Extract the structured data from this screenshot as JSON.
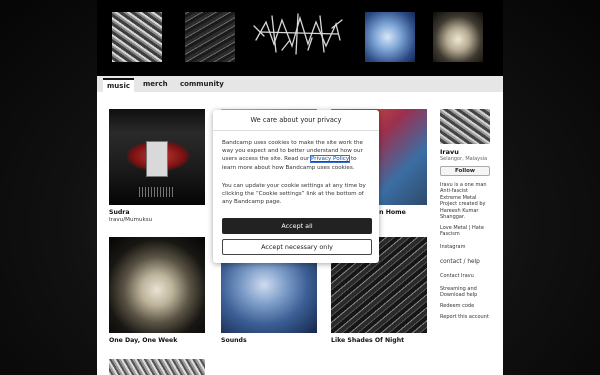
{
  "header": {
    "images": [
      "album-art-thumbnail",
      "album-art-thumbnail",
      "band-logo",
      "album-art-thumbnail",
      "album-art-thumbnail"
    ]
  },
  "tabs": [
    {
      "label": "music",
      "active": true
    },
    {
      "label": "merch",
      "active": false
    },
    {
      "label": "community",
      "active": false
    }
  ],
  "albums": [
    {
      "title": "Sudra",
      "artist": "Iravu/Mumuksu"
    },
    {
      "title": "",
      "artist": ""
    },
    {
      "title": "an Home",
      "artist": ""
    },
    {
      "title": "One Day, One Week",
      "artist": ""
    },
    {
      "title": "Sounds",
      "artist": ""
    },
    {
      "title": "Like Shades Of Night",
      "artist": ""
    },
    {
      "title": "",
      "artist": ""
    }
  ],
  "sidebar": {
    "name": "Iravu",
    "location": "Selangor, Malaysia",
    "follow_label": "Follow",
    "bio_lines": [
      "Iravu is a one man",
      "Anti-fascist",
      "Extreme Metal",
      "Project created by",
      "Hareesh Kumar",
      "Shanggar."
    ],
    "links": [
      "Love Metal | Hate",
      "Fascism",
      "Instagram"
    ],
    "contact_heading": "contact / help",
    "help_links": [
      "Contact Iravu",
      "Streaming and",
      "Download help",
      "Redeem code",
      "Report this account"
    ]
  },
  "cookie_modal": {
    "title": "We care about your privacy",
    "body_before_link": "Bandcamp uses cookies to make the site work the way you expect and to better understand how our users access the site. Read our",
    "link_text": "Privacy Policy",
    "body_after_link": "to learn more about how Bandcamp uses cookies.",
    "body2": "You can update your cookie settings at any time by clicking the “Cookie settings” link at the bottom of any Bandcamp page.",
    "accept_all_label": "Accept all",
    "accept_necessary_label": "Accept necessary only"
  }
}
